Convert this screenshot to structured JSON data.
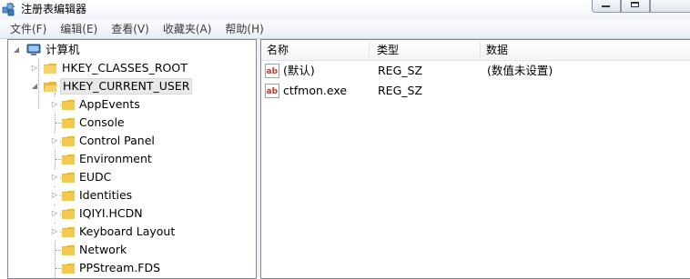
{
  "window": {
    "title": "注册表编辑器",
    "app_icon": "regedit-icon"
  },
  "menu": {
    "items": [
      "文件(F)",
      "编辑(E)",
      "查看(V)",
      "收藏夹(A)",
      "帮助(H)"
    ]
  },
  "tree": {
    "root": "计算机",
    "hives": [
      {
        "label": "HKEY_CLASSES_ROOT",
        "expanded": false,
        "selected": false
      },
      {
        "label": "HKEY_CURRENT_USER",
        "expanded": true,
        "selected": true
      }
    ],
    "children": [
      {
        "label": "AppEvents",
        "has_children": true
      },
      {
        "label": "Console",
        "has_children": false
      },
      {
        "label": "Control Panel",
        "has_children": true
      },
      {
        "label": "Environment",
        "has_children": false
      },
      {
        "label": "EUDC",
        "has_children": true
      },
      {
        "label": "Identities",
        "has_children": true
      },
      {
        "label": "IQIYI.HCDN",
        "has_children": true
      },
      {
        "label": "Keyboard Layout",
        "has_children": true
      },
      {
        "label": "Network",
        "has_children": false
      },
      {
        "label": "PPStream.FDS",
        "has_children": false
      }
    ]
  },
  "list": {
    "columns": [
      "名称",
      "类型",
      "数据"
    ],
    "rows": [
      {
        "name": "(默认)",
        "type": "REG_SZ",
        "data": "(数值未设置)",
        "icon": "string-value-icon"
      },
      {
        "name": "ctfmon.exe",
        "type": "REG_SZ",
        "data": "",
        "icon": "string-value-icon"
      }
    ]
  },
  "colors": {
    "folder": "#f2c94c",
    "selection": "#e8e8e8",
    "border": "#828790"
  }
}
